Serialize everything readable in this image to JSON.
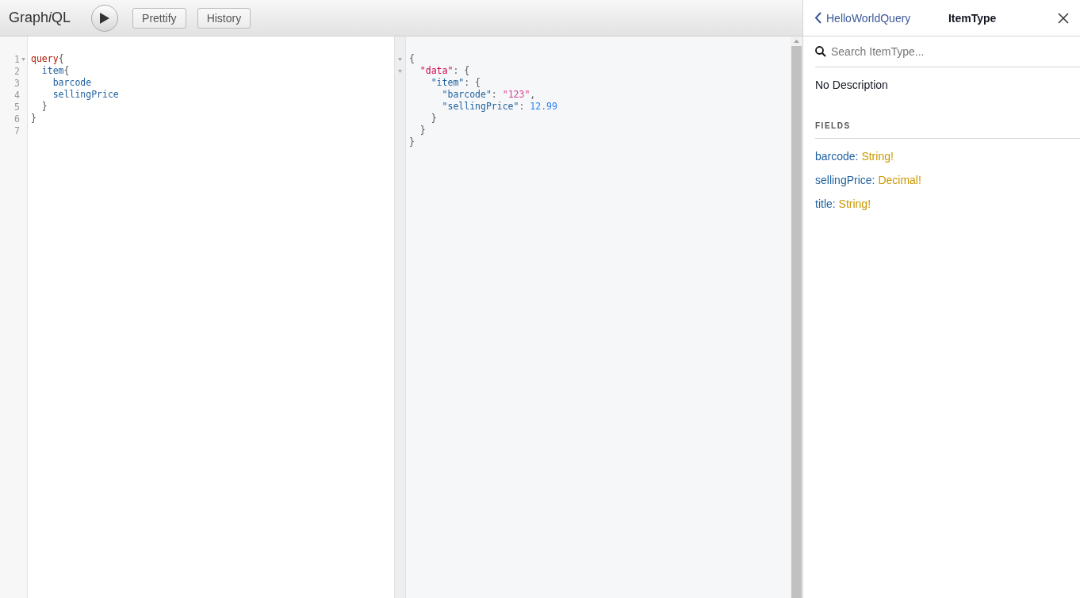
{
  "toolbar": {
    "title": "Graph",
    "title_italic": "i",
    "title_end": "QL",
    "buttons": [
      "Prettify",
      "History"
    ]
  },
  "query_editor": {
    "lines": [
      {
        "number": "1",
        "fold": true,
        "tokens": [
          {
            "kind": "keyword",
            "text": "query"
          },
          {
            "kind": "punctuation",
            "text": "{"
          }
        ]
      },
      {
        "number": "2",
        "fold": false,
        "tokens": [
          {
            "kind": "property",
            "text": "  item"
          },
          {
            "kind": "punctuation",
            "text": "{"
          }
        ]
      },
      {
        "number": "3",
        "fold": false,
        "tokens": [
          {
            "kind": "property",
            "text": "    barcode"
          }
        ]
      },
      {
        "number": "4",
        "fold": false,
        "tokens": [
          {
            "kind": "property",
            "text": "    sellingPrice"
          }
        ]
      },
      {
        "number": "5",
        "fold": false,
        "tokens": [
          {
            "kind": "punctuation",
            "text": "  }"
          }
        ]
      },
      {
        "number": "6",
        "fold": false,
        "tokens": [
          {
            "kind": "punctuation",
            "text": "}"
          }
        ]
      },
      {
        "number": "7",
        "fold": false
      }
    ]
  },
  "result_viewer": {
    "lines": [
      {
        "fold": true,
        "tokens": [
          {
            "kind": "punctuation",
            "text": "{"
          }
        ]
      },
      {
        "fold": true,
        "tokens": [
          {
            "kind": "variable",
            "text": "  \"data\""
          },
          {
            "kind": "punctuation",
            "text": ": {"
          }
        ]
      },
      {
        "fold": false,
        "tokens": [
          {
            "kind": "property",
            "text": "    \"item\""
          },
          {
            "kind": "punctuation",
            "text": ": {"
          }
        ]
      },
      {
        "fold": false,
        "tokens": [
          {
            "kind": "property",
            "text": "      \"barcode\""
          },
          {
            "kind": "punctuation",
            "text": ": "
          },
          {
            "kind": "string",
            "text": "\"123\""
          },
          {
            "kind": "punctuation",
            "text": ","
          }
        ]
      },
      {
        "fold": false,
        "tokens": [
          {
            "kind": "property",
            "text": "      \"sellingPrice\""
          },
          {
            "kind": "punctuation",
            "text": ": "
          },
          {
            "kind": "number",
            "text": "12.99"
          }
        ]
      },
      {
        "fold": false,
        "tokens": [
          {
            "kind": "punctuation",
            "text": "    }"
          }
        ]
      },
      {
        "fold": false,
        "tokens": [
          {
            "kind": "punctuation",
            "text": "  }"
          }
        ]
      },
      {
        "fold": false,
        "tokens": [
          {
            "kind": "punctuation",
            "text": "}"
          }
        ]
      }
    ]
  },
  "docs": {
    "back_label": "HelloWorldQuery",
    "title": "ItemType",
    "search": {
      "placeholder": "Search ItemType..."
    },
    "description": "No Description",
    "section_title": "FIELDS",
    "fields": [
      {
        "name": "barcode:",
        "type": "String!"
      },
      {
        "name": "sellingPrice:",
        "type": "Decimal!"
      },
      {
        "name": "title:",
        "type": "String!"
      }
    ]
  }
}
